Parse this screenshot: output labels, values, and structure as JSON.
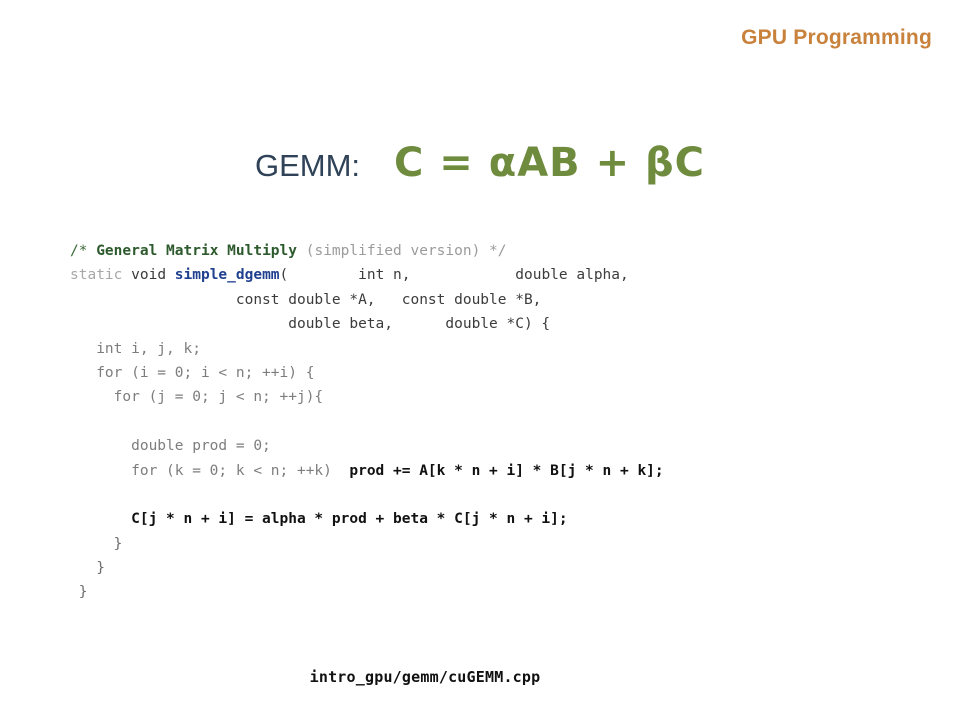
{
  "slide": {
    "header_title": "GPU Programming",
    "heading_label": "GEMM:",
    "heading_equation": "C  =  αAB  +  βC",
    "footer_path": "intro_gpu/gemm/cuGEMM.cpp"
  },
  "colors": {
    "background": "#ffffff",
    "header_orange": "#c8823c",
    "heading_navy": "#2f4257",
    "equation_green": "#6f8c3e",
    "comment_green": "#3b6b3b",
    "comment_gray": "#9b9b9b",
    "function_blue": "#1f3f8f",
    "code_default": "#3c3c3c",
    "code_bold": "#111111"
  },
  "code": {
    "language": "cpp",
    "lines": [
      {
        "n": 1,
        "text": "/* General Matrix Multiply (simplified version) */",
        "tokens": [
          {
            "t": "/* ",
            "c": "c-comment"
          },
          {
            "t": "General Matrix Multiply",
            "c": "c-comment-b"
          },
          {
            "t": " (simplified version) */",
            "c": "c-comment-dim"
          }
        ]
      },
      {
        "n": 2,
        "text": "static void simple_dgemm(        int n,            double alpha,",
        "tokens": [
          {
            "t": "static",
            "c": "c-kw-dim"
          },
          {
            "t": " ",
            "c": "c-plain"
          },
          {
            "t": "void",
            "c": "c-kw"
          },
          {
            "t": " ",
            "c": "c-plain"
          },
          {
            "t": "simple_dgemm",
            "c": "c-fn"
          },
          {
            "t": "(        int n,            double alpha,",
            "c": "c-plain"
          }
        ]
      },
      {
        "n": 3,
        "text": "                   const double *A,   const double *B,",
        "tokens": [
          {
            "t": "                   const double *A,   const double *B,",
            "c": "c-plain"
          }
        ]
      },
      {
        "n": 4,
        "text": "                         double beta,      double *C) {",
        "tokens": [
          {
            "t": "                         double beta,      double *C) {",
            "c": "c-plain"
          }
        ]
      },
      {
        "n": 5,
        "text": "   int i, j, k;",
        "tokens": [
          {
            "t": "   int i, j, k;",
            "c": "c-dim"
          }
        ]
      },
      {
        "n": 6,
        "text": "   for (i = 0; i < n; ++i) {",
        "tokens": [
          {
            "t": "   for (i = 0; i < n; ++i) {",
            "c": "c-dim"
          }
        ]
      },
      {
        "n": 7,
        "text": "     for (j = 0; j < n; ++j){",
        "tokens": [
          {
            "t": "     for (j = 0; j < n; ++j){",
            "c": "c-dim"
          }
        ]
      },
      {
        "n": 8,
        "text": "",
        "tokens": []
      },
      {
        "n": 9,
        "text": "       double prod = 0;",
        "tokens": [
          {
            "t": "       double prod = 0;",
            "c": "c-dim"
          }
        ]
      },
      {
        "n": 10,
        "text": "       for (k = 0; k < n; ++k)  prod += A[k * n + i] * B[j * n + k];",
        "tokens": [
          {
            "t": "       for (k = 0; k < n; ++k)  ",
            "c": "c-dim"
          },
          {
            "t": "prod += A[k * n + i] * B[j * n + k];",
            "c": "c-strong"
          }
        ]
      },
      {
        "n": 11,
        "text": "",
        "tokens": []
      },
      {
        "n": 12,
        "text": "       C[j * n + i] = alpha * prod + beta * C[j * n + i];",
        "tokens": [
          {
            "t": "       ",
            "c": "c-plain"
          },
          {
            "t": "C[j * n + i] = alpha * prod + beta * C[j * n + i];",
            "c": "c-strong"
          }
        ]
      },
      {
        "n": 13,
        "text": "     }",
        "tokens": [
          {
            "t": "     }",
            "c": "c-brace"
          }
        ]
      },
      {
        "n": 14,
        "text": "   }",
        "tokens": [
          {
            "t": "   }",
            "c": "c-brace"
          }
        ]
      },
      {
        "n": 15,
        "text": " }",
        "tokens": [
          {
            "t": " }",
            "c": "c-brace"
          }
        ]
      }
    ]
  }
}
